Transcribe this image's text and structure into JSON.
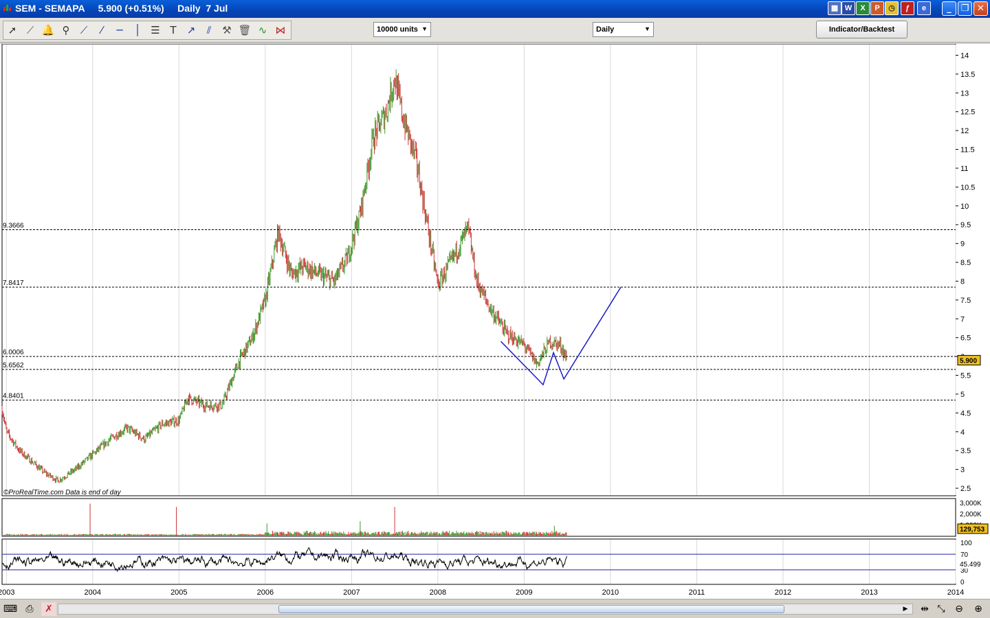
{
  "window": {
    "title": "SEM - SEMAPA     5.900 (+0.51%)     Daily  7 Jul",
    "app_icons": [
      "word-icon",
      "excel-icon",
      "powerpoint-icon",
      "clock-icon",
      "flash-icon",
      "ie-icon"
    ],
    "controls": {
      "minimize": "_",
      "restore": "❐",
      "close": "✕"
    }
  },
  "toolbar": {
    "tools": [
      "pointer-icon",
      "ruler-icon",
      "alarm-bell-icon",
      "zoom-icon",
      "segment-icon",
      "trendline-icon",
      "horizontal-line-icon",
      "vertical-line-icon",
      "fibonacci-icon",
      "text-tool-icon",
      "arrow-tool-icon",
      "parallel-lines-icon",
      "tools-icon",
      "trash-icon",
      "indicator-line-icon",
      "pattern-icon"
    ],
    "units_combo": "10000 units",
    "period_combo": "Daily",
    "indicator_button": "Indicator/Backtest"
  },
  "chart": {
    "price_axis_labels": [
      "14",
      "13.5",
      "13",
      "12.5",
      "12",
      "11.5",
      "11",
      "10.5",
      "10",
      "9.5",
      "9",
      "8.5",
      "8",
      "7.5",
      "7",
      "6.5",
      "6",
      "5.5",
      "5",
      "4.5",
      "4",
      "3.5",
      "3",
      "2.5"
    ],
    "hlines": [
      {
        "label": "9.3666",
        "value": 9.3666
      },
      {
        "label": "7.8417",
        "value": 7.8417
      },
      {
        "label": "6.0006",
        "value": 6.0006
      },
      {
        "label": "5.6562",
        "value": 5.6562
      },
      {
        "label": "4.8401",
        "value": 4.8401
      }
    ],
    "last_price_label": "5.900",
    "footer": "©ProRealTime.com  Data is end of day",
    "volume_axis_labels": [
      "3,000K",
      "2,000K",
      "1,000K"
    ],
    "volume_last_label": "129,753",
    "rsi_axis_labels": [
      "100",
      "70",
      "30",
      "0"
    ],
    "rsi_last_label": "45.499",
    "year_labels": [
      "2003",
      "2004",
      "2005",
      "2006",
      "2007",
      "2008",
      "2009",
      "2010",
      "2011",
      "2012",
      "2013",
      "2014"
    ],
    "colors": {
      "up": "#3a9a2a",
      "down": "#cc3333",
      "pattern": "#1a1ac8",
      "grid": "#d8d8d8",
      "last_price_bg": "#f0c020"
    }
  },
  "chart_data": {
    "type": "line",
    "title": "SEM - SEMAPA",
    "x": [
      2002.95,
      2003.0,
      2003.15,
      2003.3,
      2003.45,
      2003.6,
      2003.8,
      2004.0,
      2004.2,
      2004.4,
      2004.6,
      2004.8,
      2005.0,
      2005.1,
      2005.3,
      2005.5,
      2005.7,
      2005.85,
      2006.0,
      2006.15,
      2006.3,
      2006.45,
      2006.6,
      2006.8,
      2006.95,
      2007.1,
      2007.25,
      2007.4,
      2007.5,
      2007.6,
      2007.75,
      2007.9,
      2008.0,
      2008.15,
      2008.35,
      2008.45,
      2008.6,
      2008.8,
      2009.0,
      2009.15,
      2009.3,
      2009.42,
      2009.5
    ],
    "y": [
      4.6,
      4.0,
      3.5,
      3.2,
      2.9,
      2.7,
      3.0,
      3.4,
      3.8,
      4.1,
      3.8,
      4.2,
      4.3,
      4.9,
      4.7,
      4.7,
      5.9,
      6.5,
      7.5,
      9.3,
      8.2,
      8.4,
      8.2,
      8.0,
      8.6,
      9.8,
      11.8,
      12.5,
      13.4,
      12.3,
      11.2,
      9.2,
      7.9,
      8.5,
      9.4,
      8.0,
      7.3,
      6.6,
      6.3,
      5.8,
      6.4,
      6.3,
      5.9
    ],
    "ylim": [
      2.3,
      14.3
    ],
    "xlim": [
      2002.95,
      2014.0
    ],
    "pattern_overlay": {
      "x": [
        2008.73,
        2009.22,
        2009.34,
        2009.46,
        2010.12
      ],
      "y": [
        6.4,
        5.25,
        6.1,
        5.4,
        7.84
      ]
    },
    "volume_spikes": [
      {
        "x": 2003.97,
        "value": 2900
      },
      {
        "x": 2004.97,
        "value": 2600
      },
      {
        "x": 2006.02,
        "value": 1100
      },
      {
        "x": 2007.1,
        "value": 1300
      },
      {
        "x": 2007.5,
        "value": 2600
      },
      {
        "x": 2009.35,
        "value": 900
      }
    ],
    "rsi_levels": [
      70,
      30
    ]
  }
}
